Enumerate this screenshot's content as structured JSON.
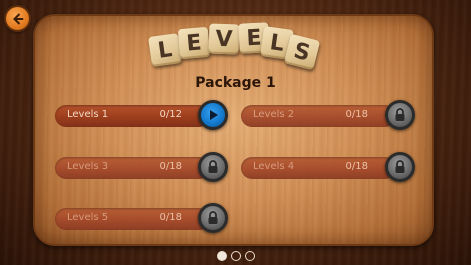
{
  "title_tiles": [
    "L",
    "E",
    "V",
    "E",
    "L",
    "S"
  ],
  "package_title": "Package 1",
  "levels": [
    {
      "name": "Levels 1",
      "progress": "0/12",
      "state": "play"
    },
    {
      "name": "Levels 2",
      "progress": "0/18",
      "state": "locked"
    },
    {
      "name": "Levels 3",
      "progress": "0/18",
      "state": "locked"
    },
    {
      "name": "Levels 4",
      "progress": "0/18",
      "state": "locked"
    },
    {
      "name": "Levels 5",
      "progress": "0/18",
      "state": "locked"
    }
  ],
  "pagination": {
    "pages": 3,
    "current": 1
  },
  "icons": {
    "back": "back-arrow-icon",
    "play": "play-icon",
    "lock": "lock-icon"
  },
  "colors": {
    "accent_orange": "#e37b1f",
    "play_blue": "#137acd",
    "bar_red": "#9c3e1c"
  }
}
